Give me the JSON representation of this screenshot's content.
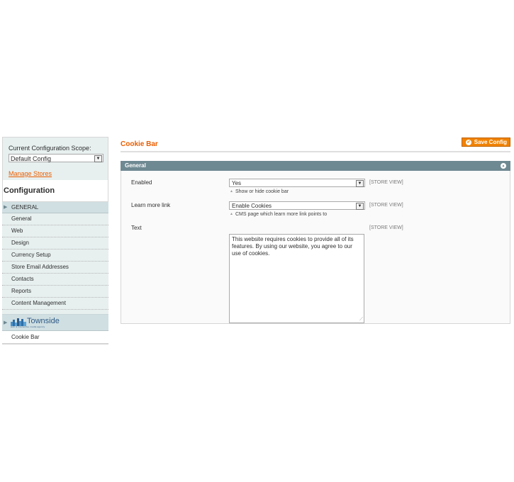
{
  "sidebar": {
    "scope_label": "Current Configuration Scope:",
    "scope_value": "Default Config",
    "manage_stores": "Manage Stores",
    "heading": "Configuration",
    "group_title": "GENERAL",
    "items": [
      {
        "label": "General"
      },
      {
        "label": "Web"
      },
      {
        "label": "Design"
      },
      {
        "label": "Currency Setup"
      },
      {
        "label": "Store Email Addresses"
      },
      {
        "label": "Contacts"
      },
      {
        "label": "Reports"
      },
      {
        "label": "Content Management"
      }
    ],
    "townside": {
      "logo_text": "Townside",
      "logo_tagline": "web & interactive media agency",
      "item": "Cookie Bar"
    }
  },
  "main": {
    "title": "Cookie Bar",
    "save_label": "Save Config",
    "fieldset_title": "General",
    "fields": {
      "enabled": {
        "label": "Enabled",
        "value": "Yes",
        "note": "Show or hide cookie bar",
        "scope": "[STORE VIEW]"
      },
      "learn_more": {
        "label": "Learn more link",
        "value": "Enable Cookies",
        "note": "CMS page which learn more link points to",
        "scope": "[STORE VIEW]"
      },
      "text": {
        "label": "Text",
        "value": "This website requires cookies to provide all of its features. By using our website, you agree to our use of cookies.",
        "scope": "[STORE VIEW]"
      }
    }
  },
  "colors": {
    "accent": "#eb5e00",
    "button": "#f18200",
    "fieldset_header": "#6f8992",
    "sidebar_bg": "#e7efef"
  },
  "icons": {
    "select_arrow": "chevron-down-icon",
    "save": "check-icon",
    "collapse": "chevron-up-icon",
    "group_arrow": "arrow-right-icon"
  }
}
